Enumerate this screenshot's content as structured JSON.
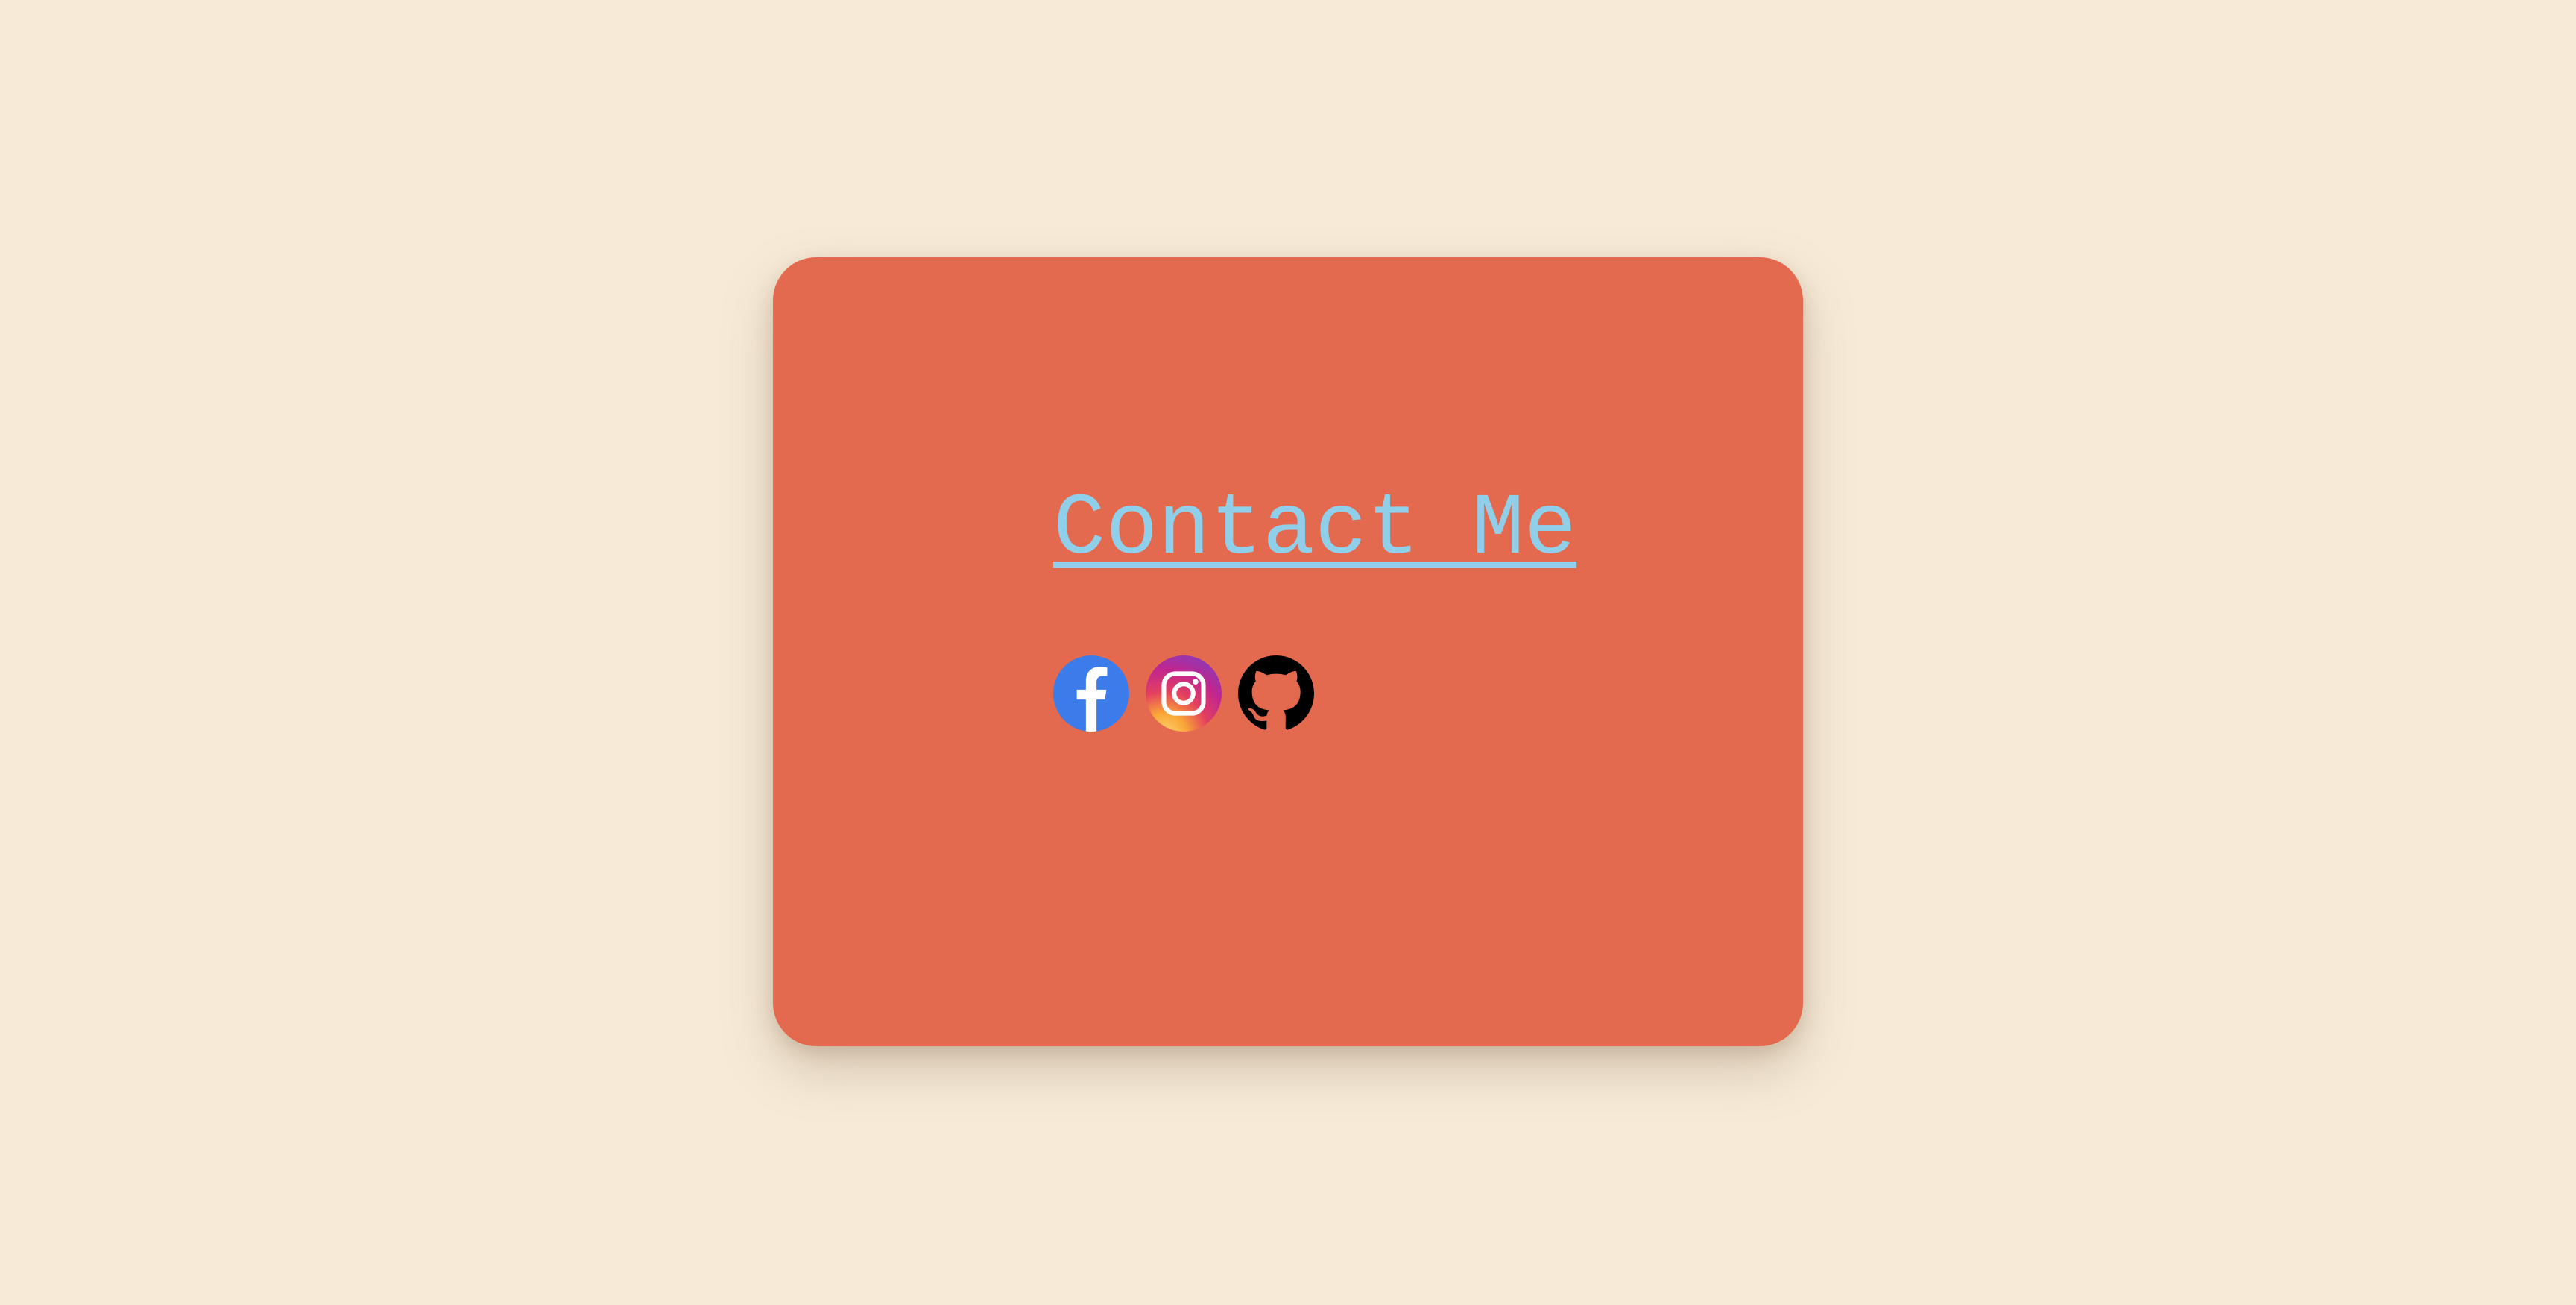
{
  "page": {
    "background_color": "#F7EBD8"
  },
  "card": {
    "background_color": "#E36A4E",
    "title": "Contact Me",
    "title_color": "#8FCFEA"
  },
  "social_links": [
    {
      "name": "facebook",
      "icon": "facebook-icon",
      "color": "#3B7BEA"
    },
    {
      "name": "instagram",
      "icon": "instagram-icon",
      "color": "#D62976"
    },
    {
      "name": "github",
      "icon": "github-icon",
      "color": "#000000"
    }
  ]
}
